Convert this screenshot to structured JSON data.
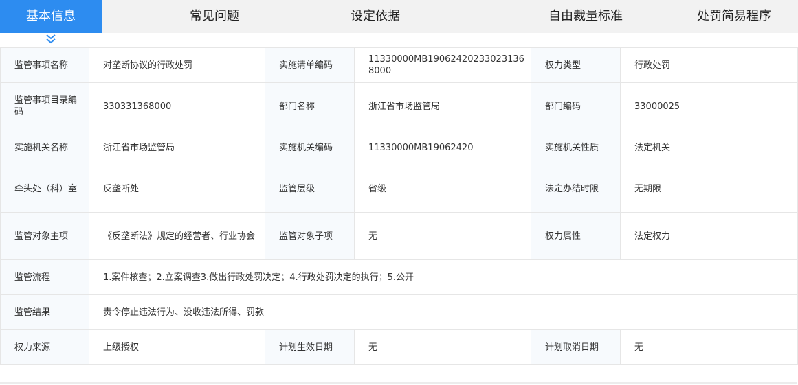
{
  "tabs": {
    "active": "基本信息",
    "faq": "常见问题",
    "basis": "设定依据",
    "discretion": "自由裁量标准",
    "simple_procedure": "处罚简易程序"
  },
  "colors": {
    "accent": "#2d8cf0",
    "label_bg": "#f7fafd",
    "border": "#e6e6e6"
  },
  "icons": {
    "active_indicator": "chevron-down-icon"
  },
  "rows": [
    {
      "l1": "监管事项名称",
      "v1": "对垄断协议的行政处罚",
      "l2": "实施清单编码",
      "v2": "11330000MB19062420233023136​8000",
      "l3": "权力类型",
      "v3": "行政处罚"
    },
    {
      "l1": "监管事项目录编码",
      "v1": "330331368000",
      "l2": "部门名称",
      "v2": "浙江省市场监管局",
      "l3": "部门编码",
      "v3": "33000025"
    },
    {
      "l1": "实施机关名称",
      "v1": "浙江省市场监管局",
      "l2": "实施机关编码",
      "v2": "11330000MB19062420",
      "l3": "实施机关性质",
      "v3": "法定机关"
    },
    {
      "l1": "牵头处（科）室",
      "v1": "反垄断处",
      "l2": "监管层级",
      "v2": "省级",
      "l3": "法定办结时限",
      "v3": "无期限"
    },
    {
      "l1": "监管对象主项",
      "v1": "《反垄断法》规定的经营者、行业协会",
      "l2": "监管对象子项",
      "v2": "无",
      "l3": "权力属性",
      "v3": "法定权力"
    }
  ],
  "flow": {
    "label": "监管流程",
    "value": "1.案件核查；2.立案调查3.做出行政处罚决定；4.行政处罚决定的执行；5.公开"
  },
  "result": {
    "label": "监管结果",
    "value": "责令停止违法行为、没收违法所得、罚款"
  },
  "last": {
    "l1": "权力来源",
    "v1": "上级授权",
    "l2": "计划生效日期",
    "v2": "无",
    "l3": "计划取消日期",
    "v3": "无"
  }
}
